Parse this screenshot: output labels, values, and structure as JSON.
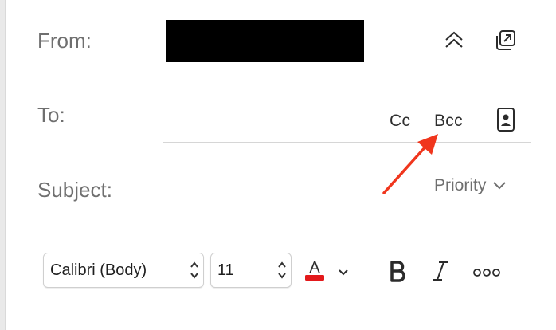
{
  "header": {
    "from_label": "From:",
    "to_label": "To:",
    "subject_label": "Subject:",
    "cc_label": "Cc",
    "bcc_label": "Bcc",
    "priority_label": "Priority"
  },
  "format_toolbar": {
    "font_value": "Calibri (Body)",
    "size_value": "11",
    "text_color": "#e3191b"
  },
  "annotation": {
    "arrow_color": "#f0361d"
  },
  "icons": [
    "collapse-up-icon",
    "popout-icon",
    "address-book-icon",
    "chevron-down-icon",
    "text-color-icon",
    "bold-icon",
    "italic-icon",
    "more-icon"
  ]
}
